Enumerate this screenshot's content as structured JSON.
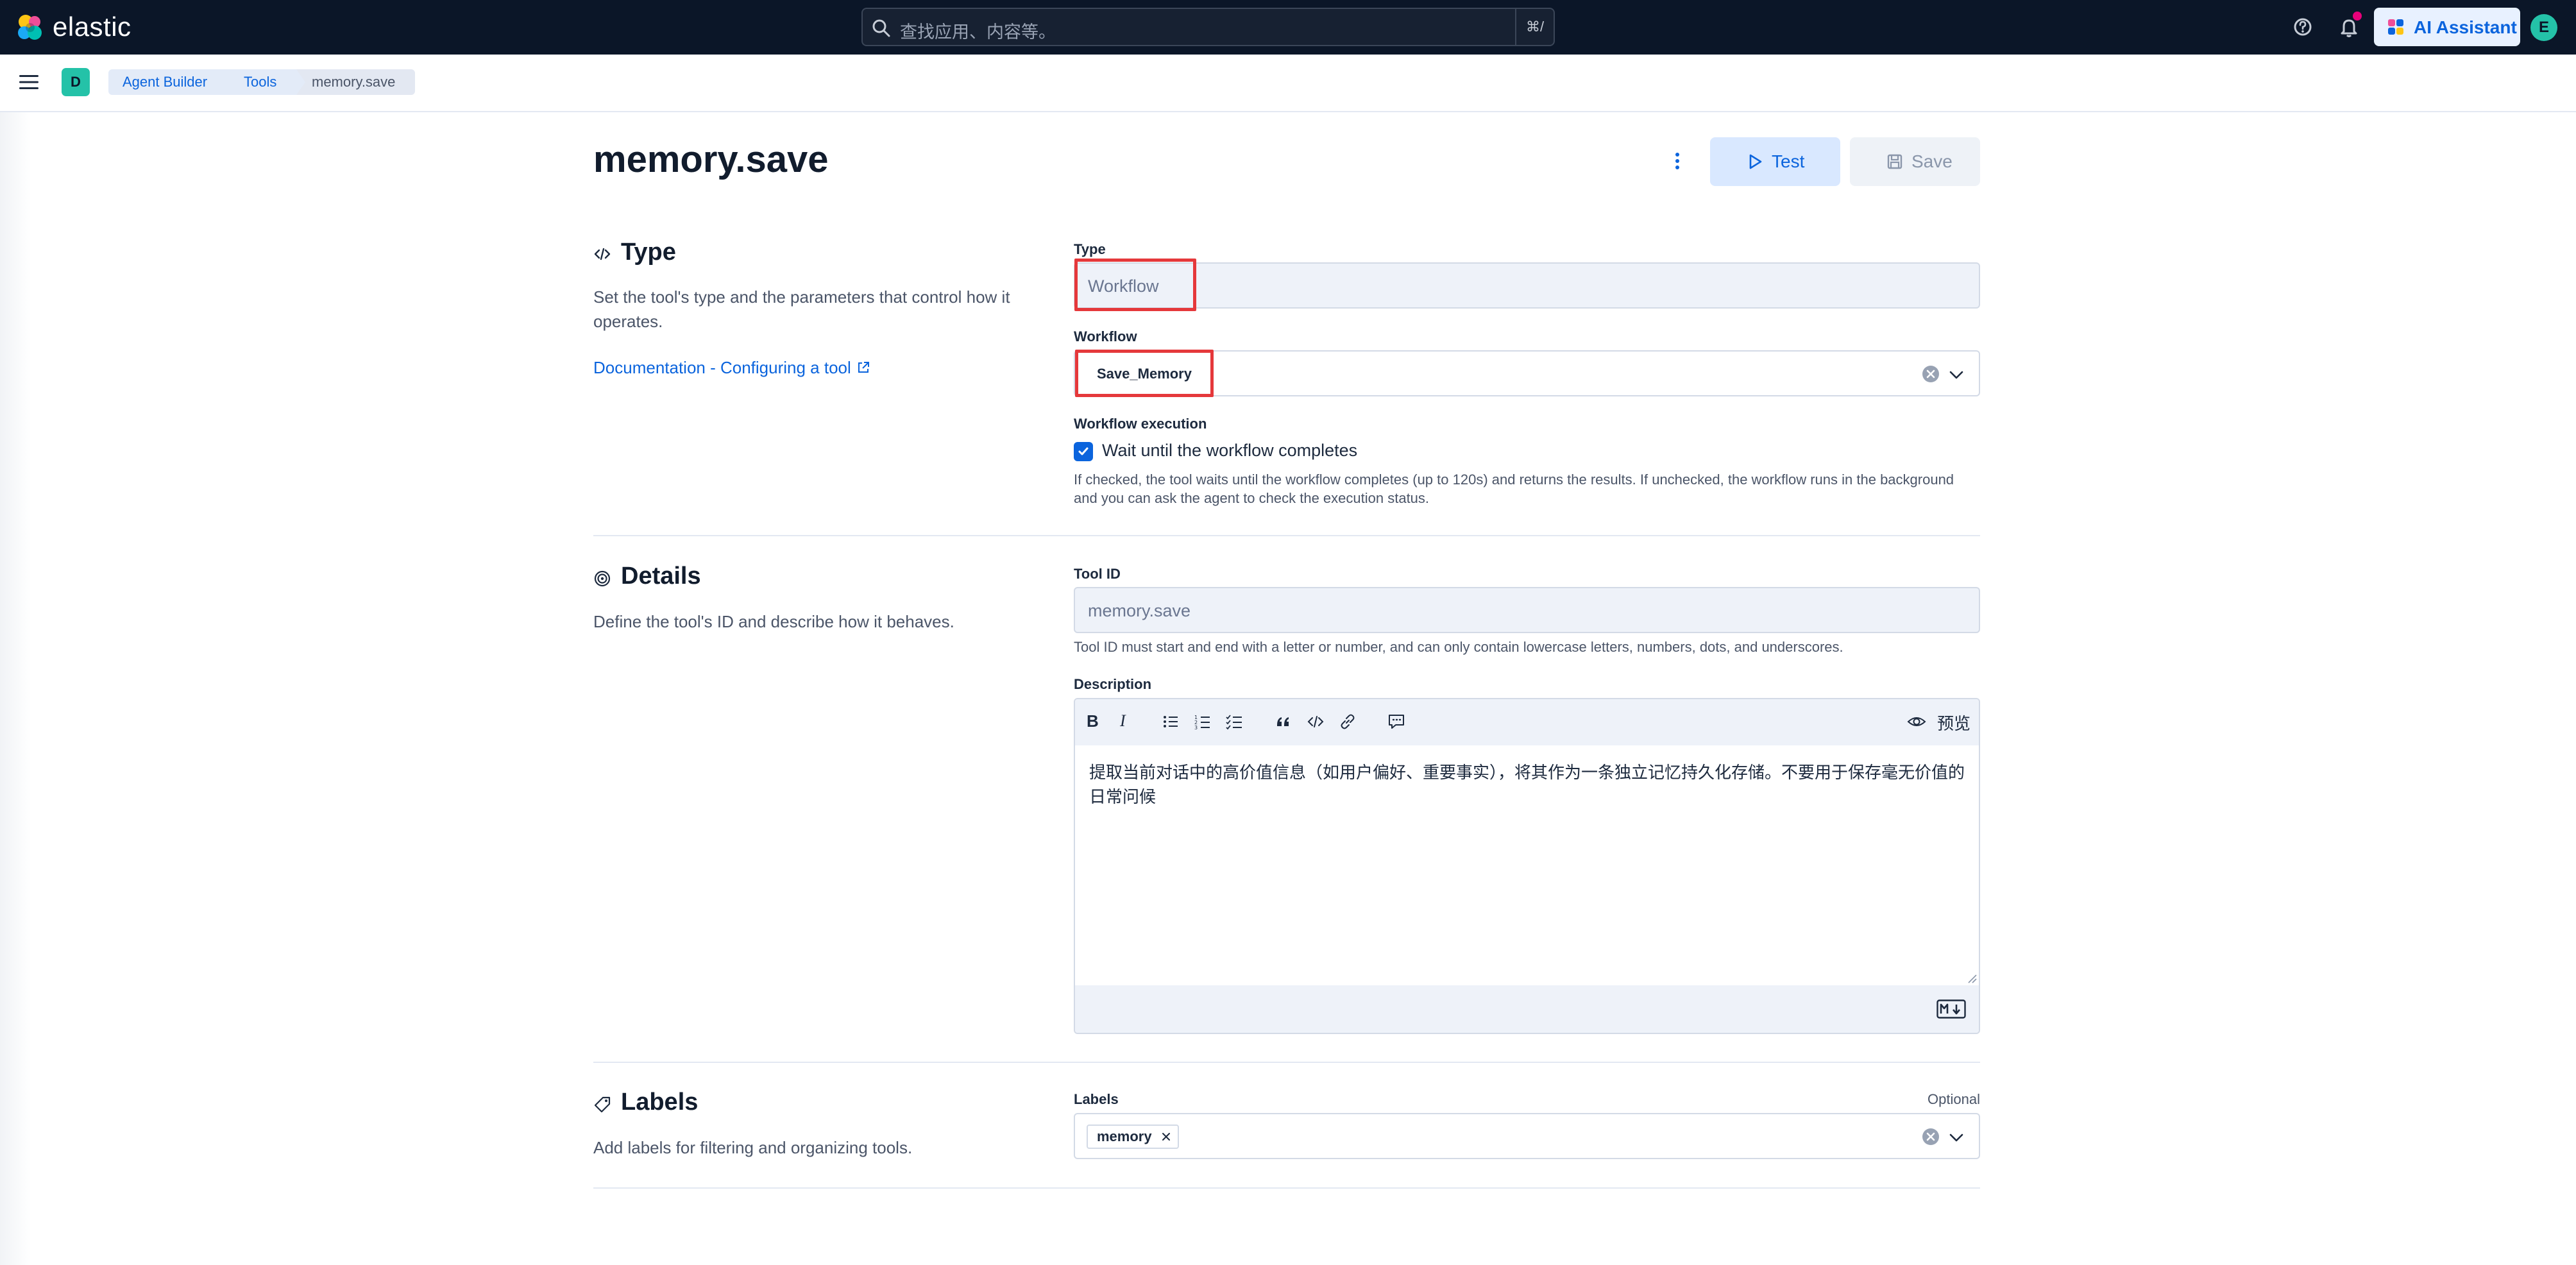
{
  "header": {
    "logo_text": "elastic",
    "search_placeholder": "查找应用、内容等。",
    "search_shortcut": "⌘/",
    "ai_assistant_label": "AI Assistant",
    "user_initial": "E"
  },
  "subbar": {
    "space_initial": "D",
    "breadcrumbs": [
      "Agent Builder",
      "Tools",
      "memory.save"
    ]
  },
  "page": {
    "title": "memory.save",
    "test_label": "Test",
    "save_label": "Save"
  },
  "type_section": {
    "title": "Type",
    "description": "Set the tool's type and the parameters that control how it operates.",
    "doc_link": "Documentation - Configuring a tool",
    "type_label": "Type",
    "type_value": "Workflow",
    "workflow_label": "Workflow",
    "workflow_value": "Save_Memory",
    "execution_label": "Workflow execution",
    "wait_label": "Wait until the workflow completes",
    "wait_checked": true,
    "wait_help": "If checked, the tool waits until the workflow completes (up to 120s) and returns the results. If unchecked, the workflow runs in the background and you can ask the agent to check the execution status."
  },
  "details_section": {
    "title": "Details",
    "description": "Define the tool's ID and describe how it behaves.",
    "tool_id_label": "Tool ID",
    "tool_id_value": "memory.save",
    "tool_id_help": "Tool ID must start and end with a letter or number, and can only contain lowercase letters, numbers, dots, and underscores.",
    "description_label": "Description",
    "preview_label": "预览",
    "description_value": "提取当前对话中的高价值信息（如用户偏好、重要事实），将其作为一条独立记忆持久化存储。不要用于保存毫无价值的日常问候"
  },
  "labels_section": {
    "title": "Labels",
    "description": "Add labels for filtering and organizing tools.",
    "labels_label": "Labels",
    "optional_label": "Optional",
    "tags": [
      "memory"
    ]
  },
  "colors": {
    "header_bg": "#0b1628",
    "accent": "#0b64dd",
    "highlight_border": "#e5383b",
    "space_badge": "#24c2a8"
  }
}
